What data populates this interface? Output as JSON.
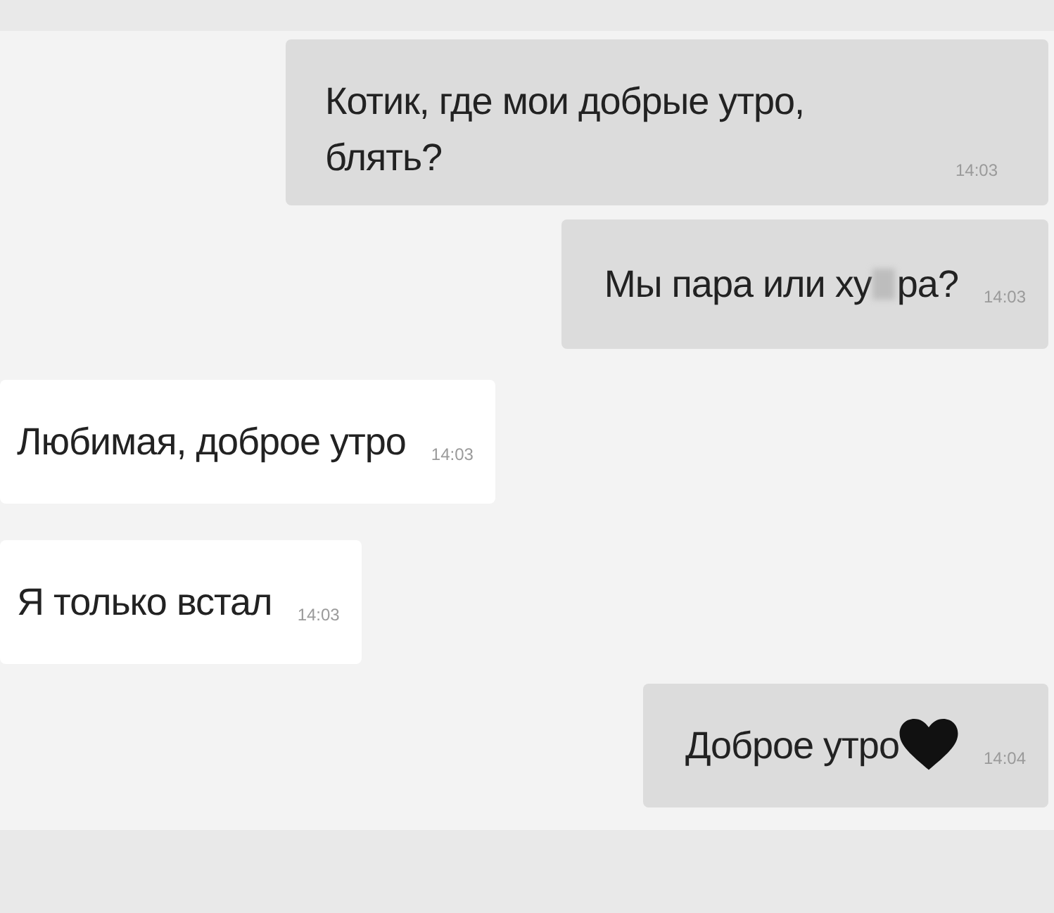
{
  "messages": [
    {
      "kind": "outgoing",
      "text": "Котик, где мои добрые утро, блять?",
      "time": "14:03"
    },
    {
      "kind": "outgoing",
      "text": "Мы пара или ху",
      "censored": true,
      "text_after": "ра?",
      "time": "14:03"
    },
    {
      "kind": "incoming",
      "text": "Любимая, доброе утро",
      "time": "14:03"
    },
    {
      "kind": "incoming",
      "text": "Я только встал",
      "time": "14:03"
    },
    {
      "kind": "outgoing",
      "text": "Доброе утро",
      "heart": true,
      "time": "14:04"
    }
  ]
}
